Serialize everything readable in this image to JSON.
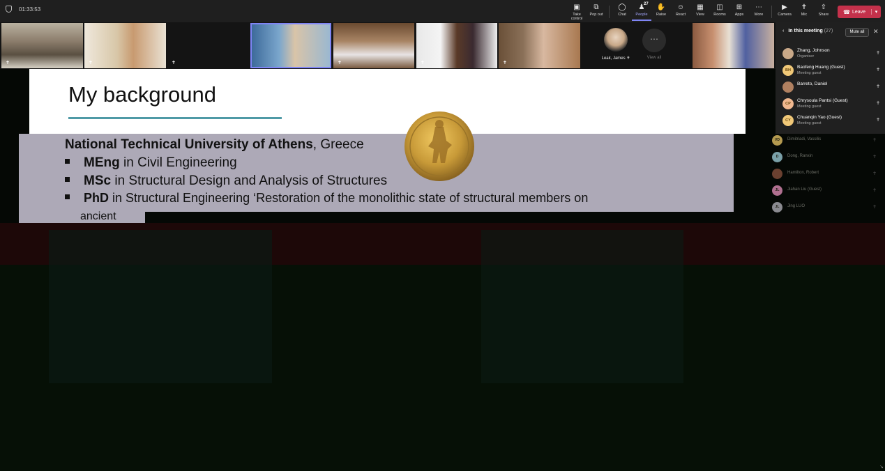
{
  "meeting": {
    "timer": "01:33:53"
  },
  "toolbar": {
    "take_control": "Take control",
    "pop_out": "Pop out",
    "chat": "Chat",
    "people": "People",
    "people_count": "27",
    "raise": "Raise",
    "react": "React",
    "view": "View",
    "rooms": "Rooms",
    "apps": "Apps",
    "more": "More",
    "camera": "Camera",
    "mic": "Mic",
    "share": "Share",
    "leave": "Leave"
  },
  "video_strip": {
    "tiles": [
      {
        "name": "",
        "muted": true
      },
      {
        "name": "",
        "muted": true
      },
      {
        "name": "",
        "muted": true
      },
      {
        "name": "",
        "muted": false
      },
      {
        "name": "",
        "muted": true
      },
      {
        "name": "",
        "muted": true
      },
      {
        "name": "",
        "muted": true
      }
    ],
    "avatar_name": "Leak, James",
    "view_all": "View all"
  },
  "people_panel": {
    "title": "In this meeting",
    "count": "(27)",
    "mute_all": "Mute all",
    "participants": [
      {
        "initials": "",
        "name": "Zhang, Johnson",
        "role": "Organiser"
      },
      {
        "initials": "BH",
        "name": "Baofeng Huang (Guest)",
        "role": "Meeting guest"
      },
      {
        "initials": "",
        "name": "Barreto, Daniel",
        "role": ""
      },
      {
        "initials": "CP",
        "name": "Chrysoula Pantsi (Guest)",
        "role": "Meeting guest"
      },
      {
        "initials": "CY",
        "name": "Chuanqin Yao (Guest)",
        "role": "Meeting guest"
      }
    ],
    "dim_participants": [
      {
        "initials": "VD",
        "name": "Dimitriadi, Vassilis",
        "color": "#b49a50"
      },
      {
        "initials": "D",
        "name": "Dong, Ranxin",
        "color": "#7aa0a8"
      },
      {
        "initials": "",
        "name": "Hamilton, Robert",
        "color": "#6a4030"
      },
      {
        "initials": "JL",
        "name": "Jiahan Liu (Guest)",
        "color": "#b07090"
      },
      {
        "initials": "JL",
        "name": "Jing LUO",
        "color": "#8a8a90"
      }
    ]
  },
  "slide": {
    "title": "My background",
    "university_bold": "National Technical University of Athens",
    "university_rest": ", Greece",
    "bullets": [
      {
        "bold": "MEng",
        "rest": " in Civil Engineering"
      },
      {
        "bold": "MSc",
        "rest": " in Structural Design and Analysis of Structures"
      },
      {
        "bold": "PhD",
        "rest": " in Structural Engineering ‘Restoration of the monolithic state of structural members on"
      }
    ],
    "continuation": "ancient"
  },
  "colors": {
    "leave": "#c4314b",
    "active_tab": "#7f85f5",
    "slide_accent": "#4f9aa6"
  }
}
